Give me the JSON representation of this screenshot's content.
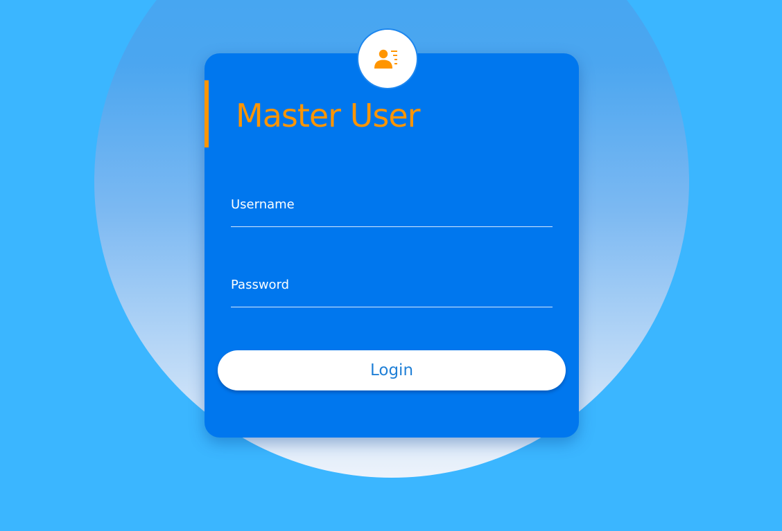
{
  "login_form": {
    "title": "Master User",
    "badge_icon": "user-list-icon",
    "username": {
      "label": "Username",
      "value": ""
    },
    "password": {
      "label": "Password",
      "value": ""
    },
    "login_label": "Login"
  },
  "colors": {
    "page_background": "#3bb6ff",
    "card_background": "#0077ee",
    "title_accent": "#ff9500",
    "button_text": "#1f7fd6"
  }
}
